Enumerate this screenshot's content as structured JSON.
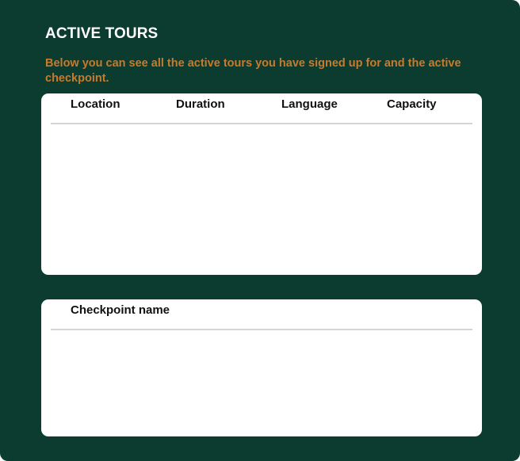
{
  "page": {
    "title": "ACTIVE TOURS",
    "description": "Below you can see all the active tours you have signed up for and the active checkpoint."
  },
  "tours_table": {
    "columns": [
      "Location",
      "Duration",
      "Language",
      "Capacity"
    ],
    "rows": []
  },
  "checkpoints_table": {
    "columns": [
      "Checkpoint name"
    ],
    "rows": []
  },
  "colors": {
    "background": "#0c3b30",
    "title": "#ffffff",
    "description": "#c77b2c",
    "panel": "#ffffff",
    "divider": "#d4d4d4"
  }
}
